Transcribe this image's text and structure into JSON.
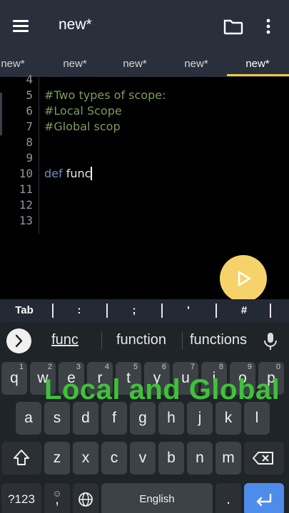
{
  "appbar": {
    "title": "new*",
    "icons": [
      "menu-icon",
      "folder-icon",
      "more-vert-icon"
    ]
  },
  "tabs": [
    "new*",
    "new*",
    "new*",
    "new*",
    "new*"
  ],
  "editor": {
    "lines": [
      {
        "num": "4",
        "text": ""
      },
      {
        "num": "5",
        "text": "#Two types of scope:"
      },
      {
        "num": "6",
        "text": "#Local Scope"
      },
      {
        "num": "7",
        "text": "#Global scop"
      },
      {
        "num": "8",
        "text": ""
      },
      {
        "num": "9",
        "text": ""
      },
      {
        "num": "10",
        "keyword": "def",
        "text": " func"
      },
      {
        "num": "11",
        "text": ""
      },
      {
        "num": "12",
        "text": ""
      },
      {
        "num": "13",
        "text": ""
      }
    ]
  },
  "symbols": [
    "Tab",
    ":",
    ";",
    "'",
    "#"
  ],
  "keyboard": {
    "suggestions": [
      "func",
      "function",
      "functions"
    ],
    "row1": [
      {
        "k": "q",
        "h": "1"
      },
      {
        "k": "w",
        "h": "2"
      },
      {
        "k": "e",
        "h": "3"
      },
      {
        "k": "r",
        "h": "4"
      },
      {
        "k": "t",
        "h": "5"
      },
      {
        "k": "y",
        "h": "6"
      },
      {
        "k": "u",
        "h": "7"
      },
      {
        "k": "i",
        "h": "8"
      },
      {
        "k": "o",
        "h": "9"
      },
      {
        "k": "p",
        "h": "0"
      }
    ],
    "row2": [
      "a",
      "s",
      "d",
      "f",
      "g",
      "h",
      "j",
      "k",
      "l"
    ],
    "row3": [
      "z",
      "x",
      "c",
      "v",
      "b",
      "n",
      "m"
    ],
    "symbols_key": "?123",
    "emoji_key": ",",
    "space_label": "English",
    "period_key": "."
  },
  "overlay": "Local and Global",
  "colors": {
    "appbar": "#29303c",
    "tab_indicator": "#f2c644",
    "comment": "#7d9a5b",
    "keyword": "#6d8fc8",
    "run_button": "#f5d36a",
    "overlay_text": "#3fc23a",
    "enter_key": "#4d8ce9"
  }
}
